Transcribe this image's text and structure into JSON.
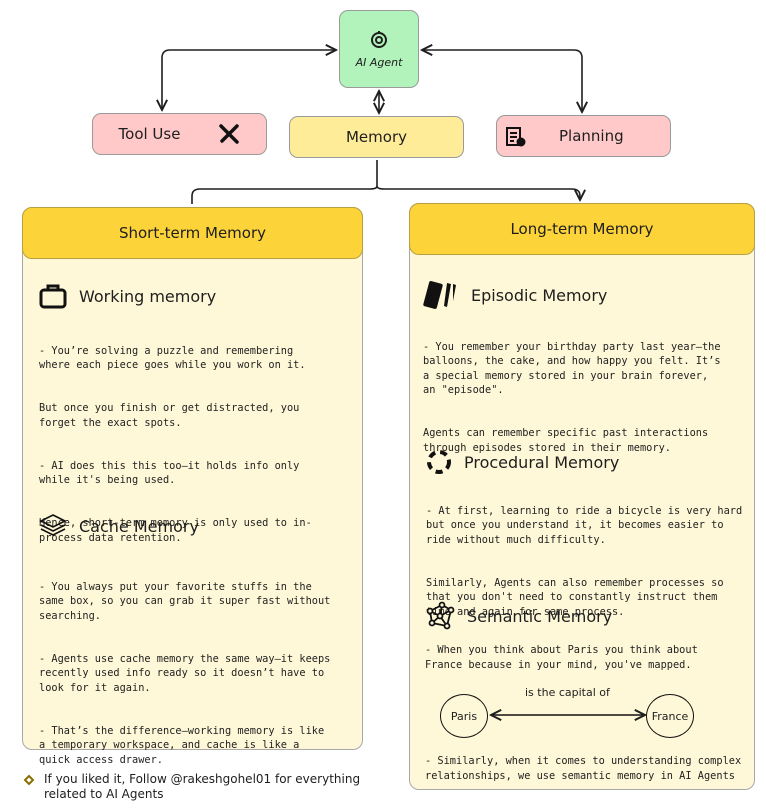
{
  "top": {
    "agent": {
      "label": "AI Agent",
      "icon": "robot-icon",
      "color": "#b2f2bb"
    },
    "tool_use": {
      "label": "Tool Use",
      "icon": "tools-icon",
      "color": "#ffc9c9"
    },
    "memory": {
      "label": "Memory",
      "color": "#ffec99"
    },
    "planning": {
      "label": "Planning",
      "icon": "clipboard-check-icon",
      "color": "#ffc9c9"
    }
  },
  "short_term": {
    "title": "Short-term Memory",
    "header_color": "#fdd33a",
    "working": {
      "title": "Working memory",
      "icon": "briefcase-icon",
      "paragraphs": [
        "- You’re solving a puzzle and remembering\nwhere each piece goes while you work on it.",
        "But once you finish or get distracted, you\nforget the exact spots.",
        "- AI does this this too—it holds info only\nwhile it's being used.",
        "Hence, short-term memory is only used to in-\nprocess data retention."
      ]
    },
    "cache": {
      "title": "Cache Memory",
      "icon": "layers-icon",
      "paragraphs": [
        "- You always put your favorite stuffs in the\nsame box, so you can grab it super fast without\nsearching.",
        "- Agents use cache memory the same way—it keeps\nrecently used info ready so it doesn’t have to\nlook for it again.",
        "- That’s the difference—working memory is like\na temporary workspace, and cache is like a\nquick access drawer."
      ]
    }
  },
  "long_term": {
    "title": "Long-term Memory",
    "header_color": "#fdd33a",
    "episodic": {
      "title": "Episodic Memory",
      "icon": "cards-icon",
      "paragraphs": [
        "- You remember your birthday party last year—the\nballoons, the cake, and how happy you felt. It’s\na special memory stored in your brain forever,\nan \"episode\".",
        "Agents can remember specific past interactions\nthrough episodes stored in their memory."
      ]
    },
    "procedural": {
      "title": "Procedural Memory",
      "icon": "loading-circle-icon",
      "paragraphs": [
        "- At first, learning to ride a bicycle is very hard\nbut once you understand it, it becomes easier to\nride without much difficulty.",
        "Similarly, Agents can also remember processes so\nthat you don't need to constantly instruct them\ntime and again for same process."
      ]
    },
    "semantic": {
      "title": "Semantic Memory",
      "icon": "network-icon",
      "intro": "- When you think about Paris you think about\nFrance because in your mind, you've mapped.",
      "graph": {
        "from": "Paris",
        "relation": "is the capital of",
        "to": "France"
      },
      "outro": "- Similarly, when it comes to understanding complex\nrelationships, we use semantic memory in AI Agents"
    },
    "watermark": "@rakeshgohel01"
  },
  "footer": {
    "text": "If you liked it, Follow @rakeshgohel01 for everything\nrelated to AI Agents",
    "icon": "diamond-icon"
  }
}
